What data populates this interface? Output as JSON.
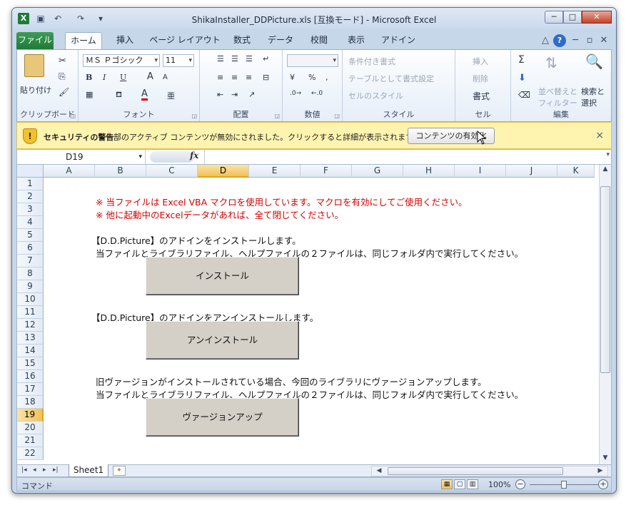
{
  "window": {
    "title": "ShikaInstaller_DDPicture.xls [互換モード] - Microsoft Excel",
    "app_icon_letter": "X",
    "controls": {
      "minimize": "─",
      "maximize": "□",
      "close": "✕"
    }
  },
  "qat": {
    "save": "▣",
    "undo": "↶",
    "redo": "↷",
    "customize": "▾"
  },
  "ribbon_tabs": [
    "ファイル",
    "ホーム",
    "挿入",
    "ページ レイアウト",
    "数式",
    "データ",
    "校閲",
    "表示",
    "アドイン"
  ],
  "ribbon_tab_right_icons": {
    "minimize_ribbon": "△",
    "help": "?",
    "wmin": "─",
    "wrestore": "▫",
    "wclose": "✕"
  },
  "ribbon": {
    "clipboard": {
      "label": "クリップボード",
      "paste": "貼り付け"
    },
    "font": {
      "label": "フォント",
      "name": "ＭＳ Ｐゴシック",
      "size": "11",
      "bold": "B",
      "italic": "I",
      "underline": "U",
      "grow": "A",
      "shrink": "A",
      "color": "A",
      "phonetic": "亜"
    },
    "alignment": {
      "label": "配置"
    },
    "number": {
      "label": "数値",
      "format": "",
      "percent": "%",
      "comma": ","
    },
    "styles": {
      "label": "スタイル",
      "conditional": "条件付き書式",
      "table": "テーブルとして書式設定",
      "cell_styles": "セルのスタイル"
    },
    "cells": {
      "label": "セル",
      "insert": "挿入",
      "delete": "削除",
      "format": "書式"
    },
    "editing": {
      "label": "編集",
      "sum": "Σ",
      "sort": "並べ替えと",
      "sort2": "フィルター",
      "find": "検索と",
      "find2": "選択"
    }
  },
  "security_bar": {
    "title": "セキュリティの警告",
    "message": "一部のアクティブ コンテンツが無効にされました。クリックすると詳細が表示されます。",
    "button": "コンテンツの有効化",
    "close": "×",
    "icon": "!"
  },
  "formula_bar": {
    "name_box": "D19",
    "fx": "fx",
    "content": ""
  },
  "columns": [
    "A",
    "B",
    "C",
    "D",
    "E",
    "F",
    "G",
    "H",
    "I",
    "J",
    "K"
  ],
  "selected_column": "D",
  "rows": [
    "1",
    "2",
    "3",
    "4",
    "5",
    "6",
    "7",
    "8",
    "9",
    "10",
    "11",
    "12",
    "13",
    "14",
    "15",
    "16",
    "17",
    "18",
    "19",
    "20",
    "21",
    "22"
  ],
  "selected_row": "19",
  "sheet_text": {
    "warn1": "※ 当ファイルは Excel VBA マクロを使用しています。マクロを有効にしてご使用ください。",
    "warn2": "※ 他に起動中のExcelデータがあれば、全て閉じてください。",
    "install_desc1": "【D.D.Picture】のアドインをインストールします。",
    "install_desc2": "当ファイルとライブラリファイル、ヘルプファイルの２ファイルは、同じフォルダ内で実行してください。",
    "uninstall_desc": "【D.D.Picture】のアドインをアンインストールします。",
    "upgrade_desc1": "旧ヴァージョンがインストールされている場合、今回のライブラリにヴァージョンアップします。",
    "upgrade_desc2": "当ファイルとライブラリファイル、ヘルプファイルの２ファイルは、同じフォルダ内で実行してください。"
  },
  "buttons": {
    "install": "インストール",
    "uninstall": "アンインストール",
    "upgrade": "ヴァージョンアップ"
  },
  "sheet_tabs": {
    "active": "Sheet1",
    "nav": [
      "|◂",
      "◂",
      "▸",
      "▸|"
    ]
  },
  "status": {
    "mode": "コマンド",
    "zoom": "100%",
    "zoom_out": "−",
    "zoom_in": "+"
  },
  "colors": {
    "warning_text": "#d40000",
    "file_tab": "#1f7a3a",
    "selection": "#f1c15a",
    "message_bar": "#fff3b0"
  }
}
